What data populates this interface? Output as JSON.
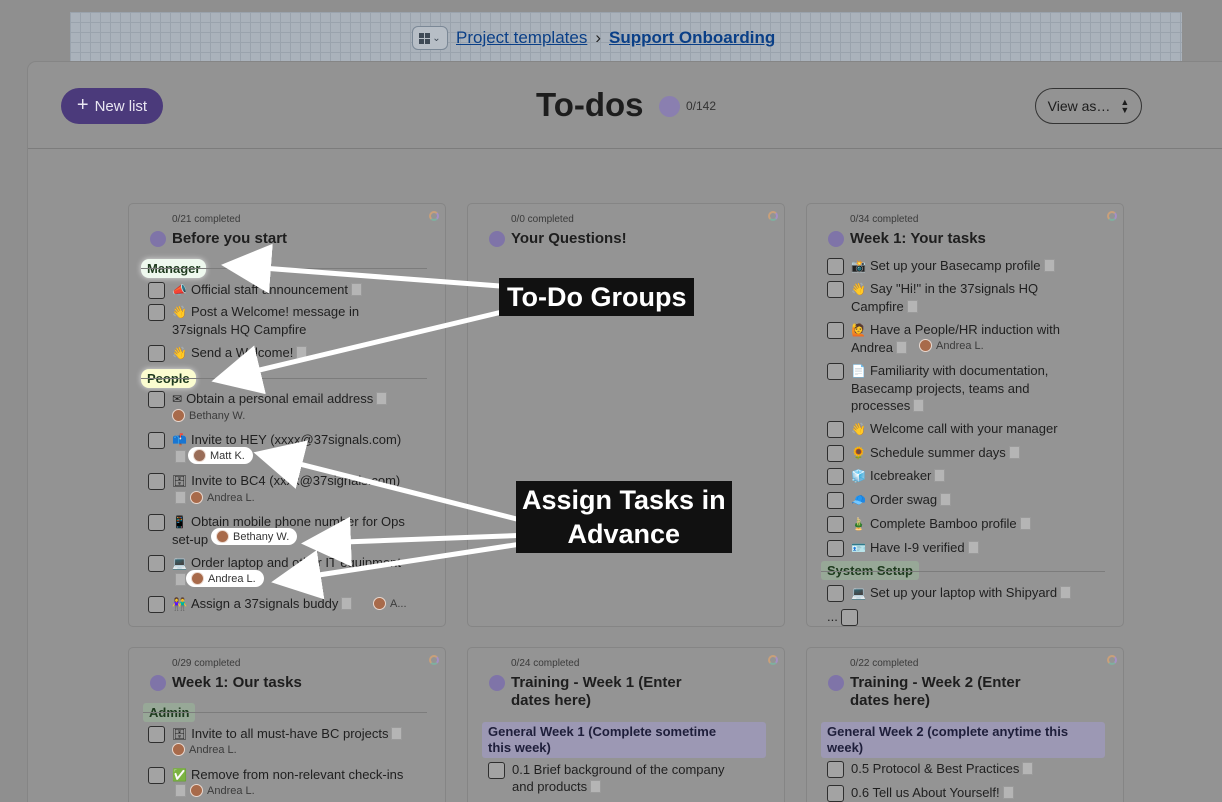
{
  "breadcrumb": {
    "parent": "Project templates",
    "separator": "›",
    "current": "Support Onboarding"
  },
  "header": {
    "new_list": "New list",
    "title": "To-dos",
    "count": "0/142",
    "view_as": "View as…"
  },
  "callouts": {
    "groups": "To-Do Groups",
    "assign_line1": "Assign Tasks in",
    "assign_line2": "Advance"
  },
  "cards": {
    "before": {
      "completed": "0/21 completed",
      "title": "Before you start",
      "group_manager": "Manager",
      "group_people": "People",
      "t1": "Official staff announcement",
      "t2a": "Post a Welcome! message in",
      "t2b": "37signals HQ Campfire",
      "t3": "Send a Welcome!",
      "t4": "Obtain a personal email address",
      "a4": "Bethany W.",
      "t5": "Invite to HEY (xxxx@37signals.com)",
      "a5": "Matt K.",
      "t6": "Invite to BC4 (xxxx@37signals.com)",
      "a6": "Andrea L.",
      "t7a": "Obtain mobile phone number for Ops",
      "t7b": "set-up",
      "a7": "Bethany W.",
      "t8": "Order laptop and other IT equipment",
      "a8": "Andrea L.",
      "t9": "Assign a 37signals buddy",
      "a9": "A..."
    },
    "questions": {
      "completed": "0/0 completed",
      "title": "Your Questions!"
    },
    "week1": {
      "completed": "0/34 completed",
      "title": "Week 1: Your tasks",
      "t1": "Set up your Basecamp profile",
      "t2a": "Say \"Hi!\" in the 37signals HQ",
      "t2b": "Campfire",
      "t3a": "Have a People/HR induction with",
      "t3b": "Andrea",
      "a3": "Andrea L.",
      "t4a": "Familiarity with documentation,",
      "t4b": "Basecamp projects, teams and",
      "t4c": "processes",
      "t5": "Welcome call with your manager",
      "t6": "Schedule summer days",
      "t7": "Icebreaker",
      "t8": "Order swag",
      "t9": "Complete Bamboo profile",
      "t10": "Have I-9 verified",
      "group_system": "System Setup",
      "t11": "Set up your laptop with Shipyard",
      "more": "..."
    },
    "our": {
      "completed": "0/29 completed",
      "title": "Week 1: Our tasks",
      "group_admin": "Admin",
      "t1": "Invite to all must-have BC projects",
      "a1": "Andrea L.",
      "t2": "Remove from non-relevant check-ins",
      "a2": "Andrea L."
    },
    "training1": {
      "completed": "0/24 completed",
      "title_a": "Training - Week 1 (Enter",
      "title_b": "dates here)",
      "group_a": "General Week 1 (Complete sometime",
      "group_b": "this week)",
      "t1a": "0.1 Brief background of the company",
      "t1b": "and products"
    },
    "training2": {
      "completed": "0/22 completed",
      "title_a": "Training - Week 2 (Enter",
      "title_b": "dates here)",
      "group_a": "General Week 2 (complete anytime this",
      "group_b": "week)",
      "t1": "0.5 Protocol & Best Practices",
      "t2": "0.6 Tell us About Yourself!"
    }
  },
  "colors": {
    "accent": "#4b3a7b",
    "callout_bg": "#111111",
    "arrow": "#ffffff"
  }
}
